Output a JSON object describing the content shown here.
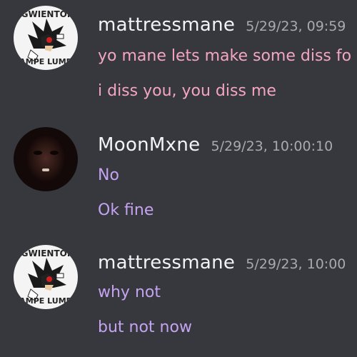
{
  "messages": [
    {
      "author": "mattressmane",
      "timestamp": "5/29/23, 09:59",
      "avatar": "shadow-hedgehog-avatar",
      "avatar_text_top": "GWIENTOI",
      "avatar_text_bottom": "AMPE LUMP",
      "text_color": "#f4a6c0",
      "lines": [
        "yo mane lets make some diss fo",
        "i diss you, you diss me"
      ]
    },
    {
      "author": "MoonMxne",
      "timestamp": "5/29/23, 10:00:10",
      "avatar": "user-photo-avatar",
      "text_color": "#c5a3f0",
      "lines": [
        "No",
        "Ok fine"
      ]
    },
    {
      "author": "mattressmane",
      "timestamp": "5/29/23, 10:00",
      "avatar": "shadow-hedgehog-avatar",
      "avatar_text_top": "GWIENTOI",
      "avatar_text_bottom": "AMPE LUMP",
      "text_color": "#c5a3f0",
      "lines": [
        "why not",
        "but not now"
      ]
    }
  ]
}
